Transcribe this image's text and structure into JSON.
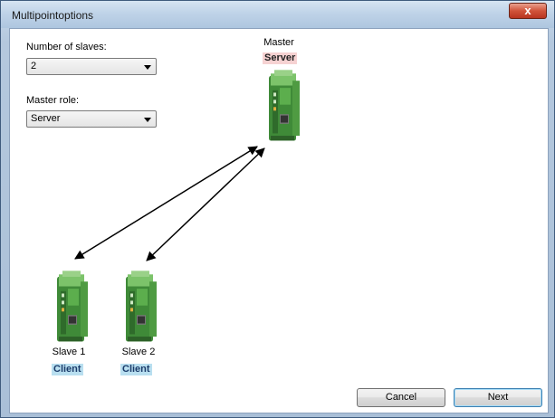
{
  "window": {
    "title": "Multipointoptions",
    "close_glyph": "x"
  },
  "form": {
    "slaves_label": "Number of slaves:",
    "slaves_value": "2",
    "role_label": "Master role:",
    "role_value": "Server"
  },
  "master": {
    "caption": "Master",
    "role": "Server"
  },
  "slaves": [
    {
      "caption": "Slave 1",
      "role": "Client"
    },
    {
      "caption": "Slave 2",
      "role": "Client"
    }
  ],
  "buttons": {
    "cancel": "Cancel",
    "next": "Next"
  },
  "colors": {
    "device_green": "#5aa84a",
    "server_badge": "#f6d2d2",
    "client_badge": "#b9dff0"
  },
  "icons": {
    "device": "din-rail-module-icon",
    "dropdown": "chevron-down-icon",
    "close": "close-icon"
  }
}
